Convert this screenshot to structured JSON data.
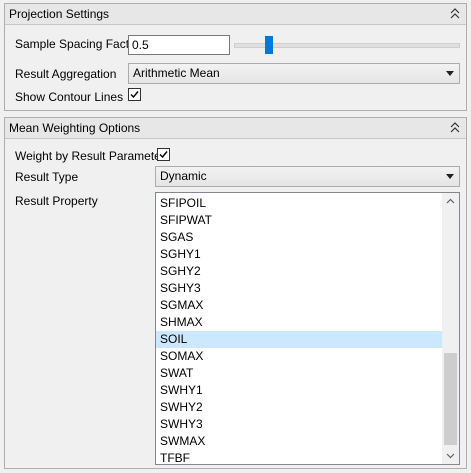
{
  "projection": {
    "title": "Projection Settings",
    "sample_spacing_label": "Sample Spacing Factor",
    "sample_spacing_value": "0.5",
    "result_aggregation_label": "Result Aggregation",
    "result_aggregation_value": "Arithmetic Mean",
    "show_contours_label": "Show Contour Lines",
    "show_contours_checked": true
  },
  "weighting": {
    "title": "Mean Weighting Options",
    "weight_by_param_label": "Weight by Result Parameter",
    "weight_by_param_checked": true,
    "result_type_label": "Result Type",
    "result_type_value": "Dynamic",
    "result_property_label": "Result Property",
    "properties": [
      "SFIPOIL",
      "SFIPWAT",
      "SGAS",
      "SGHY1",
      "SGHY2",
      "SGHY3",
      "SGMAX",
      "SHMAX",
      "SOIL",
      "SOMAX",
      "SWAT",
      "SWHY1",
      "SWHY2",
      "SWHY3",
      "SWMAX",
      "TFBF"
    ],
    "selected_property": "SOIL"
  },
  "colors": {
    "accent": "#0078d7",
    "selection": "#cce8ff"
  }
}
